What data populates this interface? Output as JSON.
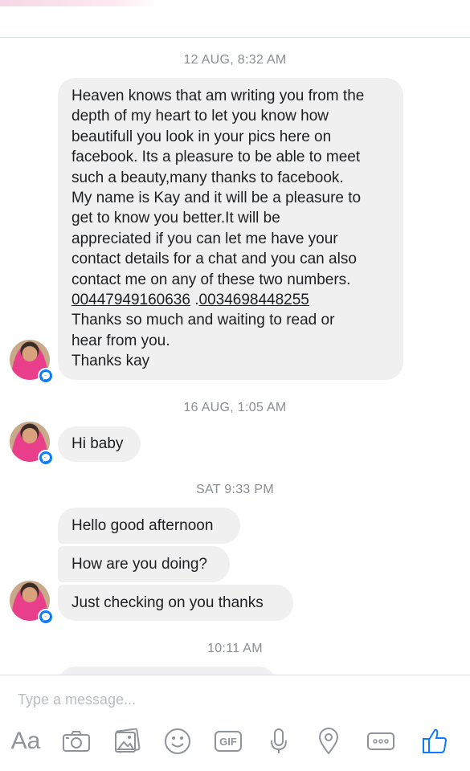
{
  "composer": {
    "placeholder": "Type a message...",
    "font_button_label": "Aa",
    "gif_label": "GIF"
  },
  "conversation": {
    "groups": [
      {
        "timestamp": "12 AUG, 8:32 AM",
        "messages": [
          {
            "lines": [
              "Heaven knows that am writing you from the",
              "depth of my heart to let you know how",
              "beautifull you look in your pics here on",
              "facebook. Its a pleasure to be able to meet",
              "such a beauty,many thanks to facebook.",
              "My name is Kay and it will be a pleasure to",
              "get to know you better.It will be",
              "appreciated if you can let me have your",
              "contact details for a chat and you can also",
              "contact me on any of these two numbers."
            ],
            "phone_1": "00447949160636",
            "phone_separator": " .",
            "phone_2": "0034698448255",
            "closing_lines": [
              "Thanks so much and waiting to read or",
              "hear from you.",
              "Thanks kay"
            ]
          }
        ]
      },
      {
        "timestamp": "16 AUG, 1:05 AM",
        "messages": [
          {
            "text": "Hi baby"
          }
        ]
      },
      {
        "timestamp": "SAT 9:33 PM",
        "messages": [
          {
            "text": "Hello good afternoon"
          },
          {
            "text": "How are you doing?"
          },
          {
            "text": "Just checking on you thanks"
          }
        ]
      },
      {
        "timestamp": "10:11 AM",
        "messages": []
      }
    ]
  },
  "colors": {
    "bubble": "#f0f0f0",
    "messenger_blue": "#0a7cff",
    "timestamp": "#8a8d91",
    "toolbar_icon": "#90949a"
  }
}
